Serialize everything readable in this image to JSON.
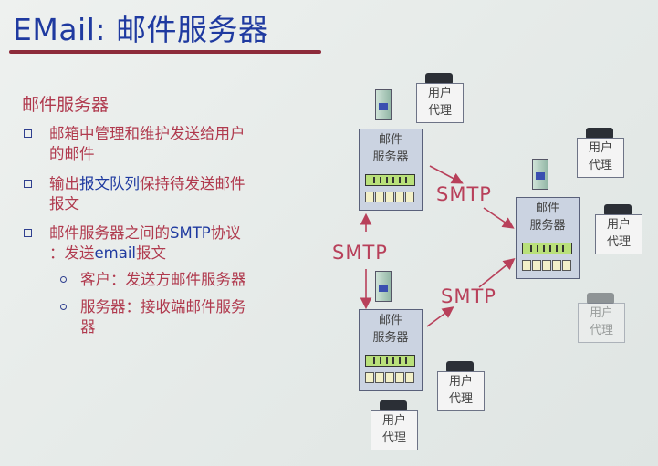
{
  "slide": {
    "title": "EMail: 邮件服务器",
    "subhead": "邮件服务器",
    "bullets": [
      {
        "line1": "邮箱中管理和维护发送给用户",
        "line2": "的邮件"
      },
      {
        "line1_a": "输出",
        "line1_b": "报文队列",
        "line1_c": "保持待发送邮件",
        "line2": "报文"
      },
      {
        "line1_a": "邮件服务器之间的",
        "line1_b": "SMTP",
        "line1_c": "协议",
        "line2_a": "：发送",
        "line2_b": "email",
        "line2_c": "报文"
      }
    ],
    "sub_bullets": [
      {
        "text": "客户：发送方邮件服务器"
      },
      {
        "line1": "服务器：接收端邮件服务",
        "line2": "器"
      }
    ]
  },
  "diagram": {
    "server_label_1": "邮件",
    "server_label_2": "服务器",
    "agent_label_1": "用户",
    "agent_label_2": "代理",
    "smtp_label": "SMTP"
  }
}
